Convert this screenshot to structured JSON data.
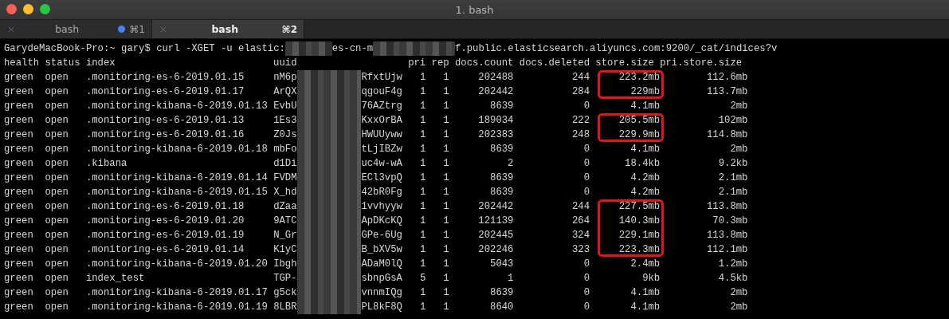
{
  "window": {
    "title": "1. bash"
  },
  "tabs": [
    {
      "label": "bash",
      "shortcut": "⌘1",
      "selected": false,
      "activity": true
    },
    {
      "label": "bash",
      "shortcut": "⌘2",
      "selected": true,
      "activity": false
    }
  ],
  "command": {
    "prompt": "GarydeMacBook-Pro:~ gary$ curl -XGET -u elastic:",
    "part_2": "es-cn-m",
    "part_3": "f.public.elasticsearch.aliyuncs.com:9200/_cat/indices?v"
  },
  "table": {
    "columns": [
      "health",
      "status",
      "index",
      "uuid",
      "pri",
      "rep",
      "docs.count",
      "docs.deleted",
      "store.size",
      "pri.store.size"
    ],
    "rows": [
      {
        "health": "green",
        "status": "open",
        "index": ".monitoring-es-6-2019.01.15",
        "uuid_start": "nM6p",
        "uuid_end": "RfxtUjw",
        "pri": "1",
        "rep": "1",
        "docs_count": "202488",
        "docs_deleted": "244",
        "store_size": "223.2mb",
        "pri_store_size": "112.6mb",
        "highlighted": true
      },
      {
        "health": "green",
        "status": "open",
        "index": ".monitoring-es-6-2019.01.17",
        "uuid_start": "ArQX",
        "uuid_end": "qgouF4g",
        "pri": "1",
        "rep": "1",
        "docs_count": "202442",
        "docs_deleted": "284",
        "store_size": "229mb",
        "pri_store_size": "113.7mb",
        "highlighted": true
      },
      {
        "health": "green",
        "status": "open",
        "index": ".monitoring-kibana-6-2019.01.13",
        "uuid_start": "EvbU",
        "uuid_end": "76AZtrg",
        "pri": "1",
        "rep": "1",
        "docs_count": "8639",
        "docs_deleted": "0",
        "store_size": "4.1mb",
        "pri_store_size": "2mb",
        "highlighted": false
      },
      {
        "health": "green",
        "status": "open",
        "index": ".monitoring-es-6-2019.01.13",
        "uuid_start": "1Es3",
        "uuid_end": "KxxOrBA",
        "pri": "1",
        "rep": "1",
        "docs_count": "189034",
        "docs_deleted": "222",
        "store_size": "205.5mb",
        "pri_store_size": "102mb",
        "highlighted": true
      },
      {
        "health": "green",
        "status": "open",
        "index": ".monitoring-es-6-2019.01.16",
        "uuid_start": "Z0Js",
        "uuid_end": "HWUUyww",
        "pri": "1",
        "rep": "1",
        "docs_count": "202383",
        "docs_deleted": "248",
        "store_size": "229.9mb",
        "pri_store_size": "114.8mb",
        "highlighted": true
      },
      {
        "health": "green",
        "status": "open",
        "index": ".monitoring-kibana-6-2019.01.18",
        "uuid_start": "mbFo",
        "uuid_end": "tLjIBZw",
        "pri": "1",
        "rep": "1",
        "docs_count": "8639",
        "docs_deleted": "0",
        "store_size": "4.1mb",
        "pri_store_size": "2mb",
        "highlighted": false
      },
      {
        "health": "green",
        "status": "open",
        "index": ".kibana",
        "uuid_start": "d1Di",
        "uuid_end": "uc4w-wA",
        "pri": "1",
        "rep": "1",
        "docs_count": "2",
        "docs_deleted": "0",
        "store_size": "18.4kb",
        "pri_store_size": "9.2kb",
        "highlighted": false
      },
      {
        "health": "green",
        "status": "open",
        "index": ".monitoring-kibana-6-2019.01.14",
        "uuid_start": "FVDM",
        "uuid_end": "ECl3vpQ",
        "pri": "1",
        "rep": "1",
        "docs_count": "8639",
        "docs_deleted": "0",
        "store_size": "4.2mb",
        "pri_store_size": "2.1mb",
        "highlighted": false
      },
      {
        "health": "green",
        "status": "open",
        "index": ".monitoring-kibana-6-2019.01.15",
        "uuid_start": "X_hd",
        "uuid_end": "42bR0Fg",
        "pri": "1",
        "rep": "1",
        "docs_count": "8639",
        "docs_deleted": "0",
        "store_size": "4.2mb",
        "pri_store_size": "2.1mb",
        "highlighted": false
      },
      {
        "health": "green",
        "status": "open",
        "index": ".monitoring-es-6-2019.01.18",
        "uuid_start": "dZaa",
        "uuid_end": "1vvhyyw",
        "pri": "1",
        "rep": "1",
        "docs_count": "202442",
        "docs_deleted": "244",
        "store_size": "227.5mb",
        "pri_store_size": "113.8mb",
        "highlighted": true
      },
      {
        "health": "green",
        "status": "open",
        "index": ".monitoring-es-6-2019.01.20",
        "uuid_start": "9ATC",
        "uuid_end": "ApDKcKQ",
        "pri": "1",
        "rep": "1",
        "docs_count": "121139",
        "docs_deleted": "264",
        "store_size": "140.3mb",
        "pri_store_size": "70.3mb",
        "highlighted": true
      },
      {
        "health": "green",
        "status": "open",
        "index": ".monitoring-es-6-2019.01.19",
        "uuid_start": "N_Gr",
        "uuid_end": "GPe-6Ug",
        "pri": "1",
        "rep": "1",
        "docs_count": "202445",
        "docs_deleted": "324",
        "store_size": "229.1mb",
        "pri_store_size": "113.8mb",
        "highlighted": true
      },
      {
        "health": "green",
        "status": "open",
        "index": ".monitoring-es-6-2019.01.14",
        "uuid_start": "K1yC",
        "uuid_end": "B_bXV5w",
        "pri": "1",
        "rep": "1",
        "docs_count": "202246",
        "docs_deleted": "323",
        "store_size": "223.3mb",
        "pri_store_size": "112.1mb",
        "highlighted": true
      },
      {
        "health": "green",
        "status": "open",
        "index": ".monitoring-kibana-6-2019.01.20",
        "uuid_start": "Ibgh",
        "uuid_end": "ADaM0lQ",
        "pri": "1",
        "rep": "1",
        "docs_count": "5043",
        "docs_deleted": "0",
        "store_size": "2.4mb",
        "pri_store_size": "1.2mb",
        "highlighted": false
      },
      {
        "health": "green",
        "status": "open",
        "index": "index_test",
        "uuid_start": "TGP-",
        "uuid_end": "sbnpGsA",
        "pri": "5",
        "rep": "1",
        "docs_count": "1",
        "docs_deleted": "0",
        "store_size": "9kb",
        "pri_store_size": "4.5kb",
        "highlighted": false
      },
      {
        "health": "green",
        "status": "open",
        "index": ".monitoring-kibana-6-2019.01.17",
        "uuid_start": "g5ck",
        "uuid_end": "vnnmIQg",
        "pri": "1",
        "rep": "1",
        "docs_count": "8639",
        "docs_deleted": "0",
        "store_size": "4.1mb",
        "pri_store_size": "2mb",
        "highlighted": false
      },
      {
        "health": "green",
        "status": "open",
        "index": ".monitoring-kibana-6-2019.01.19",
        "uuid_start": "8LBR",
        "uuid_end": "PL8kF8Q",
        "pri": "1",
        "rep": "1",
        "docs_count": "8640",
        "docs_deleted": "0",
        "store_size": "4.1mb",
        "pri_store_size": "2mb",
        "highlighted": false
      }
    ]
  }
}
